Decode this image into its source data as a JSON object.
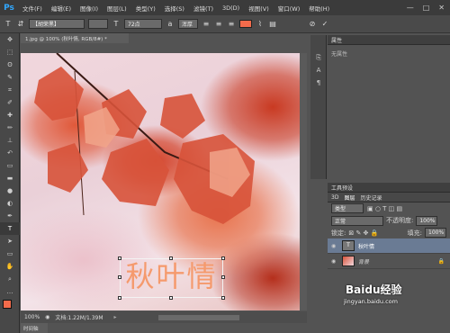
{
  "app": {
    "logo": "Ps"
  },
  "menu": [
    "文件(F)",
    "编辑(E)",
    "图像(I)",
    "图层(L)",
    "类型(Y)",
    "选择(S)",
    "滤镜(T)",
    "3D(D)",
    "视图(V)",
    "窗口(W)",
    "帮助(H)"
  ],
  "window_controls": {
    "minimize": "—",
    "maximize": "□",
    "close": "✕"
  },
  "options": {
    "tool_icon": "T",
    "font_family": "【胡荣黑】",
    "font_size": "72点",
    "antialias": "浑厚",
    "text_color": "#f36b4b"
  },
  "document": {
    "tab": "1.jpg @ 100% (秋叶情, RGB/8#) *",
    "zoom": "100%",
    "doc_info": "文档:1.22M/1.39M",
    "text": "秋叶情",
    "bottom_tab": "时间轴"
  },
  "properties": {
    "title": "属性",
    "empty_text": "无属性"
  },
  "layers_panel": {
    "tabs": [
      "3D",
      "图层",
      "历史记录"
    ],
    "tools_label": "工具预设",
    "filter": "类型",
    "blend_mode": "正常",
    "opacity_label": "不透明度:",
    "opacity": "100%",
    "lock_label": "锁定:",
    "fill_label": "填充:",
    "fill": "100%",
    "layers": [
      {
        "name": "秋叶情",
        "type": "T"
      },
      {
        "name": "背景"
      }
    ]
  },
  "watermark": {
    "text": "Baidu经验",
    "url": "jingyan.baidu.com"
  }
}
